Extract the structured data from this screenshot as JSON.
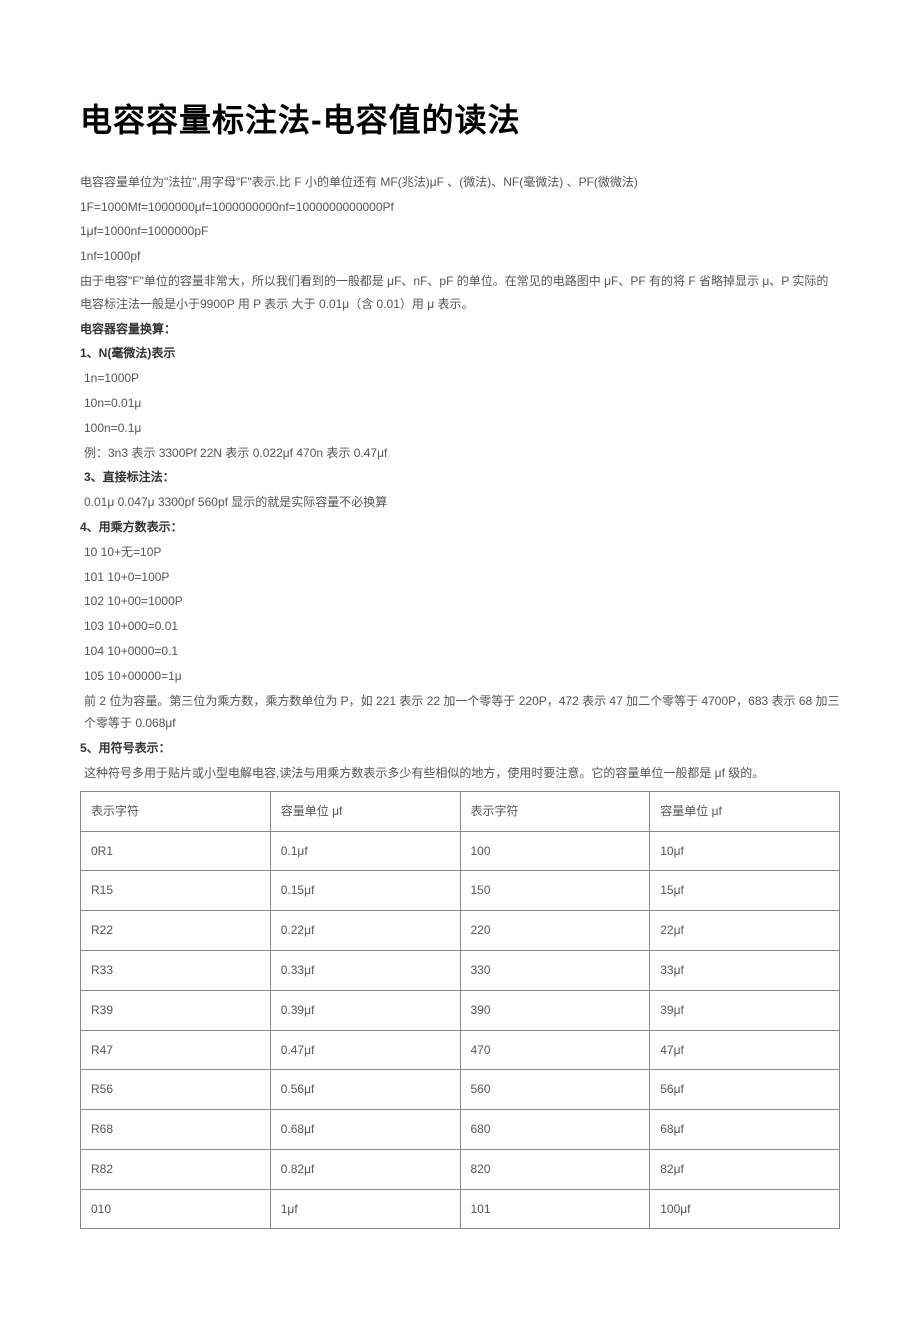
{
  "title": "电容容量标注法-电容值的读法",
  "intro": [
    "电容容量单位为\"法拉\",用字母\"F\"表示.比 F 小的单位还有 MF(兆法)μF 、(微法)、NF(毫微法) 、PF(微微法)",
    "1F=1000Mf=1000000μf=1000000000nf=1000000000000Pf",
    "1μf=1000nf=1000000pF",
    "1nf=1000pf",
    "由于电容\"F\"单位的容量非常大，所以我们看到的一般都是 μF、nF、pF 的单位。在常见的电路图中 μF、PF 有的将 F 省略掉显示 μ、P 实际的电容标注法一般是小于9900P 用 P 表示  大于 0.01μ（含 0.01）用 μ 表示。"
  ],
  "section_conv_title": "电容器容量换算：",
  "section1": {
    "title": "1、N(毫微法)表示",
    "lines": [
      "1n=1000P",
      "10n=0.01μ",
      "100n=0.1μ",
      "例：3n3 表示 3300Pf  22N 表示 0.022μf   470n 表示 0.47μf"
    ]
  },
  "section3": {
    "title": "3、直接标注法：",
    "lines": [
      "0.01μ 0.047μ  3300pf  560pf  显示的就是实际容量不必换算"
    ]
  },
  "section4": {
    "title": "4、用乘方数表示：",
    "lines": [
      "10  10+无=10P",
      "101 10+0=100P",
      "102 10+00=1000P",
      "103 10+000=0.01",
      "104 10+0000=0.1",
      "105 10+00000=1μ",
      "前 2 位为容量。第三位为乘方数，乘方数单位为 P，如 221 表示 22 加一个零等于 220P，472 表示 47 加二个零等于 4700P，683 表示 68 加三个零等于 0.068μf"
    ]
  },
  "section5": {
    "title": "5、用符号表示：",
    "desc": "这种符号多用于贴片或小型电解电容,读法与用乘方数表示多少有些相似的地方，使用时要注意。它的容量单位一般都是 μf 级的。",
    "headers": [
      "表示字符",
      "容量单位  μf",
      "表示字符",
      "容量单位  μf"
    ],
    "rows": [
      [
        "0R1",
        "0.1μf",
        "100",
        "10μf"
      ],
      [
        "R15",
        "0.15μf",
        "150",
        "15μf"
      ],
      [
        "R22",
        "0.22μf",
        "220",
        "22μf"
      ],
      [
        "R33",
        "0.33μf",
        "330",
        "33μf"
      ],
      [
        "R39",
        "0.39μf",
        "390",
        "39μf"
      ],
      [
        "R47",
        "0.47μf",
        "470",
        "47μf"
      ],
      [
        "R56",
        "0.56μf",
        "560",
        "56μf"
      ],
      [
        "R68",
        "0.68μf",
        "680",
        "68μf"
      ],
      [
        "R82",
        "0.82μf",
        "820",
        "82μf"
      ],
      [
        "010",
        "1μf",
        "101",
        "100μf"
      ]
    ]
  }
}
